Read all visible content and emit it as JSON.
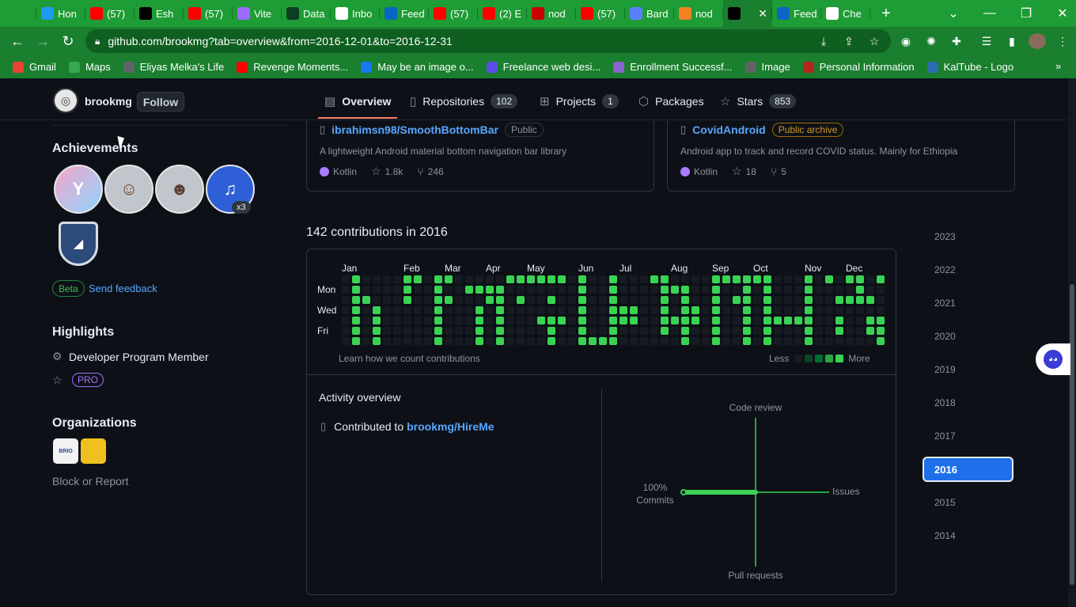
{
  "browser": {
    "tabs": [
      {
        "label": "",
        "icon": "globe-icon",
        "color": "#1e9c35"
      },
      {
        "label": "Hon",
        "icon": "twitter-icon",
        "color": "#1d9bf0"
      },
      {
        "label": "(57)",
        "icon": "youtube-icon",
        "color": "#ff0000"
      },
      {
        "label": "Esh",
        "icon": "github-icon",
        "color": "#000000"
      },
      {
        "label": "(57)",
        "icon": "youtube-icon",
        "color": "#ff0000"
      },
      {
        "label": "Vite",
        "icon": "vite-icon",
        "color": "#9d6bff"
      },
      {
        "label": "Data",
        "icon": "mongodb-icon",
        "color": "#0f3d23"
      },
      {
        "label": "Inbo",
        "icon": "gmail-icon",
        "color": "#ffffff"
      },
      {
        "label": "Feed",
        "icon": "linkedin-icon",
        "color": "#0a66c2"
      },
      {
        "label": "(57)",
        "icon": "youtube-icon",
        "color": "#ff0000"
      },
      {
        "label": "(2) E",
        "icon": "youtube-icon",
        "color": "#ff0000"
      },
      {
        "label": "nod",
        "icon": "npm-icon",
        "color": "#cb0000"
      },
      {
        "label": "(57)",
        "icon": "youtube-icon",
        "color": "#ff0000"
      },
      {
        "label": "Bard",
        "icon": "bard-icon",
        "color": "#5a7fff"
      },
      {
        "label": "nod",
        "icon": "stackoverflow-icon",
        "color": "#f48024"
      },
      {
        "label": "",
        "icon": "github-icon",
        "color": "#000000",
        "active": true
      },
      {
        "label": "Feed",
        "icon": "linkedin-icon",
        "color": "#0a66c2"
      },
      {
        "label": "Che",
        "icon": "google-icon",
        "color": "#ffffff"
      }
    ],
    "url": "github.com/brookmg?tab=overview&from=2016-12-01&to=2016-12-31",
    "bookmarks": [
      {
        "label": "Gmail",
        "icon": "gmail-icon",
        "color": "#ea4335"
      },
      {
        "label": "Maps",
        "icon": "maps-icon",
        "color": "#34a853"
      },
      {
        "label": "Eliyas Melka's Life",
        "icon": "globe-icon",
        "color": "#5f6368"
      },
      {
        "label": "Revenge Moments...",
        "icon": "youtube-icon",
        "color": "#ff0000"
      },
      {
        "label": "May be an image o...",
        "icon": "facebook-icon",
        "color": "#1877f2"
      },
      {
        "label": "Freelance web desi...",
        "icon": "w-icon",
        "color": "#5c4ee5"
      },
      {
        "label": "Enrollment Successf...",
        "icon": "bar-icon",
        "color": "#8a63d2"
      },
      {
        "label": "Image",
        "icon": "globe-icon",
        "color": "#5f6368"
      },
      {
        "label": "Personal Information",
        "icon": "feather-icon",
        "color": "#b3261e"
      },
      {
        "label": "KalTube - Logo",
        "icon": "k-icon",
        "color": "#2b6cb0"
      }
    ]
  },
  "profile": {
    "username": "brookmg",
    "follow_label": "Follow",
    "tabs": [
      {
        "label": "Overview",
        "count": null,
        "icon": "book-icon"
      },
      {
        "label": "Repositories",
        "count": "102",
        "icon": "repo-icon"
      },
      {
        "label": "Projects",
        "count": "1",
        "icon": "table-icon"
      },
      {
        "label": "Packages",
        "count": null,
        "icon": "package-icon"
      },
      {
        "label": "Stars",
        "count": "853",
        "icon": "star-icon"
      }
    ]
  },
  "sidebar": {
    "achievements_title": "Achievements",
    "badge_multiplier": "x3",
    "beta_label": "Beta",
    "feedback_label": "Send feedback",
    "highlights_title": "Highlights",
    "highlight_developer": "Developer Program Member",
    "highlight_pro": "PRO",
    "organizations_title": "Organizations",
    "org_labels": [
      "BRIO",
      ""
    ],
    "block_label": "Block or Report"
  },
  "repos": [
    {
      "name": "ibrahimsn98/SmoothBottomBar",
      "visibility": "Public",
      "description": "A lightweight Android material bottom navigation bar library",
      "language": "Kotlin",
      "stars": "1.8k",
      "forks": "246"
    },
    {
      "name": "CovidAndroid",
      "visibility": "Public archive",
      "description": "Android app to track and record COVID status. Mainly for Ethiopia",
      "language": "Kotlin",
      "stars": "18",
      "forks": "5"
    }
  ],
  "contributions": {
    "title": "142 contributions in 2016",
    "months": [
      "Jan",
      "Feb",
      "Mar",
      "Apr",
      "May",
      "Jun",
      "Jul",
      "Aug",
      "Sep",
      "Oct",
      "Nov",
      "Dec"
    ],
    "days": [
      "Mon",
      "Wed",
      "Fri"
    ],
    "learn_label": "Learn how we count contributions",
    "legend_less": "Less",
    "legend_more": "More",
    "colors": {
      "empty": "#161b22",
      "l1": "#0e4429",
      "l2": "#006d32",
      "l3": "#26a641",
      "l4": "#39d353"
    }
  },
  "activity": {
    "title": "Activity overview",
    "contributed_to": "Contributed to",
    "repo": "brookmg/HireMe",
    "axes": {
      "top": "Code review",
      "right": "Issues",
      "bottom": "Pull requests",
      "left": "Commits",
      "left_pct": "100%"
    }
  },
  "years": [
    "2023",
    "2022",
    "2021",
    "2020",
    "2019",
    "2018",
    "2017",
    "2016",
    "2015",
    "2014"
  ],
  "selected_year": "2016"
}
